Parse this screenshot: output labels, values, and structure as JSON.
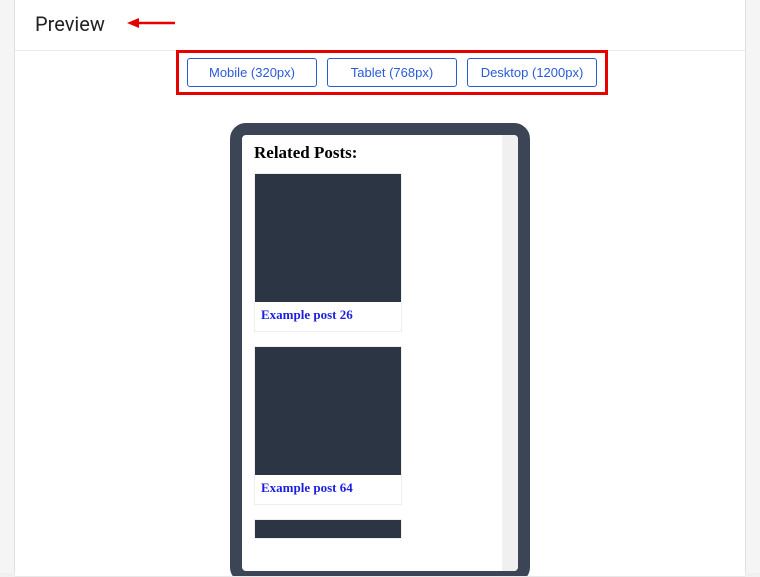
{
  "header": {
    "title": "Preview"
  },
  "buttons": {
    "mobile": "Mobile (320px)",
    "tablet": "Tablet (768px)",
    "desktop": "Desktop (1200px)"
  },
  "annotation": {
    "arrow_color": "#e60000"
  },
  "preview": {
    "heading": "Related Posts:",
    "posts": [
      {
        "title": "Example post 26"
      },
      {
        "title": "Example post 64"
      }
    ]
  }
}
